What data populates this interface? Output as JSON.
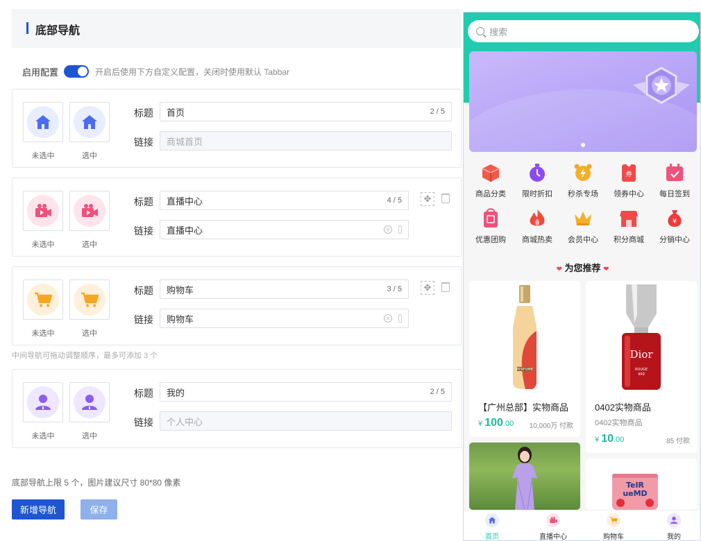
{
  "header": {
    "title": "底部导航"
  },
  "enable": {
    "label": "启用配置",
    "hint": "开启后使用下方自定义配置，关闭时使用默认 Tabbar"
  },
  "captions": {
    "unselected": "未选中",
    "selected": "选中"
  },
  "fields": {
    "title_label": "标题",
    "link_label": "链接"
  },
  "nav_items": [
    {
      "title": "首页",
      "count": "2 / 5",
      "link": "商城首页",
      "icon": "home-icon",
      "color": "#4b6cf0"
    },
    {
      "title": "直播中心",
      "count": "4 / 5",
      "link": "直播中心",
      "icon": "live-video-icon",
      "color": "#f0507a"
    },
    {
      "title": "购物车",
      "count": "3 / 5",
      "link": "购物车",
      "icon": "cart-icon",
      "color": "#f5a623"
    },
    {
      "title": "我的",
      "count": "2 / 5",
      "link": "个人中心",
      "icon": "user-icon",
      "color": "#8a5cf0"
    }
  ],
  "middle_tip": "中间导航可拖动调整顺序，最多可添加 3 个",
  "footer_tip": "底部导航上限 5 个，图片建议尺寸 80*80 像素",
  "buttons": {
    "add": "新增导航",
    "save": "保存"
  },
  "preview": {
    "search_placeholder": "搜索",
    "categories": [
      {
        "label": "商品分类",
        "icon": "box-icon",
        "color": "#f05a4a"
      },
      {
        "label": "限时折扣",
        "icon": "timer-icon",
        "color": "#8a4cf0"
      },
      {
        "label": "秒杀专场",
        "icon": "alarm-icon",
        "color": "#f5a623"
      },
      {
        "label": "领券中心",
        "icon": "coupon-icon",
        "color": "#f04a4a"
      },
      {
        "label": "每日签到",
        "icon": "calendar-check-icon",
        "color": "#f0507a"
      },
      {
        "label": "优惠团购",
        "icon": "group-buy-icon",
        "color": "#f0507a"
      },
      {
        "label": "商城热卖",
        "icon": "fire-icon",
        "color": "#f04a3a"
      },
      {
        "label": "会员中心",
        "icon": "crown-icon",
        "color": "#f5a623"
      },
      {
        "label": "积分商城",
        "icon": "store-icon",
        "color": "#f04a4a"
      },
      {
        "label": "分销中心",
        "icon": "money-bag-icon",
        "color": "#f03a3a"
      }
    ],
    "recommend_title": "为您推荐",
    "products": [
      {
        "name": "【广州总部】实物商品",
        "subtitle": "",
        "price_symbol": "¥",
        "price_int": "100",
        "price_dec": ".00",
        "sold": "10,000万 付款"
      },
      {
        "name": "0402实物商品",
        "subtitle": "0402实物商品",
        "price_symbol": "¥",
        "price_int": "10",
        "price_dec": ".00",
        "sold": "85 付款"
      }
    ],
    "product_image_text": {
      "brand": "Dior",
      "line1": "ROUGE",
      "line2": "999",
      "bottle_label": "PERFUME",
      "snack1": "TeIR",
      "snack2": "ueMD"
    },
    "tabbar": [
      {
        "label": "首页",
        "active": true
      },
      {
        "label": "直播中心",
        "active": false
      },
      {
        "label": "购物车",
        "active": false
      },
      {
        "label": "我的",
        "active": false
      }
    ],
    "accent": "#1fcdae"
  }
}
